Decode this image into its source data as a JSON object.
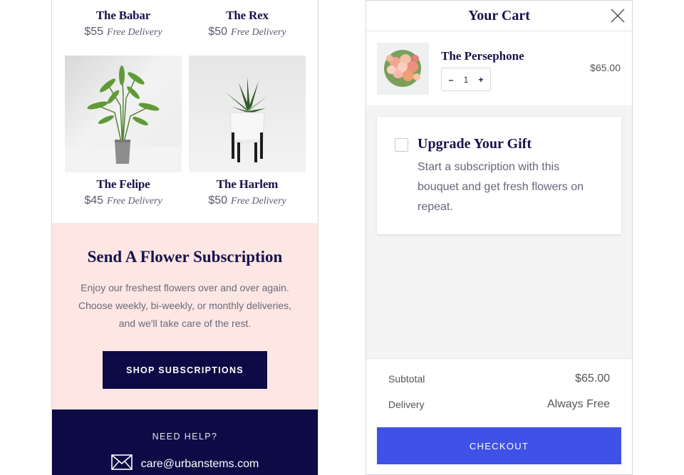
{
  "products": [
    {
      "name": "The Babar",
      "price": "$55",
      "delivery": "Free Delivery"
    },
    {
      "name": "The Rex",
      "price": "$50",
      "delivery": "Free Delivery"
    },
    {
      "name": "The Felipe",
      "price": "$45",
      "delivery": "Free Delivery"
    },
    {
      "name": "The Harlem",
      "price": "$50",
      "delivery": "Free Delivery"
    }
  ],
  "subscription": {
    "title": "Send A Flower Subscription",
    "body": "Enjoy our freshest flowers over and over again. Choose weekly, bi-weekly, or monthly deliveries, and we'll take care of the rest.",
    "button": "SHOP SUBSCRIPTIONS"
  },
  "help": {
    "title": "NEED HELP?",
    "email": "care@urbanstems.com",
    "icon": "envelope-icon"
  },
  "cart": {
    "title": "Your Cart",
    "close_icon": "close-icon",
    "item": {
      "name": "The Persephone",
      "qty": "1",
      "price": "$65.00",
      "minus": "–",
      "plus": "+"
    },
    "upgrade": {
      "title": "Upgrade Your Gift",
      "body": "Start a subscription with this bouquet and get fresh flowers on repeat."
    },
    "subtotal_label": "Subtotal",
    "subtotal_value": "$65.00",
    "delivery_label": "Delivery",
    "delivery_value": "Always Free",
    "checkout": "CHECKOUT"
  },
  "colors": {
    "navy": "#0d0a45",
    "pink": "#fde6e4",
    "checkout_blue": "#3f51e6"
  }
}
